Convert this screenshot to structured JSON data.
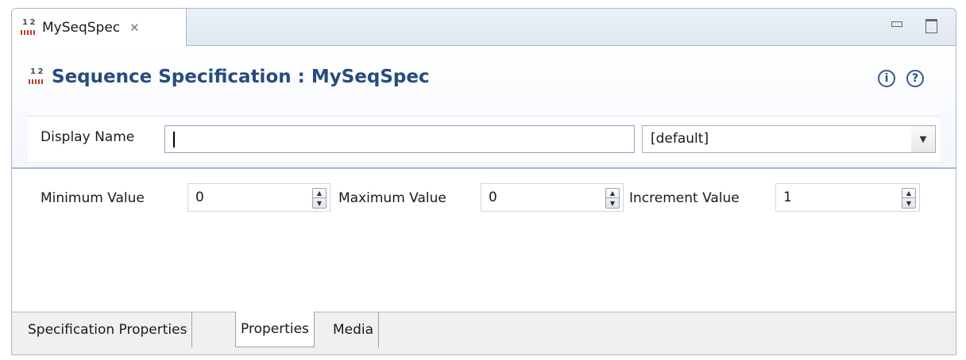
{
  "editor_tab": {
    "label": "MySeqSpec",
    "close_glyph": "✕"
  },
  "header": {
    "title": "Sequence Specification : MySeqSpec",
    "icons": [
      "info-icon",
      "help-icon"
    ]
  },
  "display_name": {
    "label": "Display Name",
    "value": "",
    "language_select": "[default]"
  },
  "fields": {
    "minimum": {
      "label": "Minimum Value",
      "value": "0"
    },
    "maximum": {
      "label": "Maximum Value",
      "value": "0"
    },
    "increment": {
      "label": "Increment Value",
      "value": "1"
    }
  },
  "bottom_tabs": [
    {
      "label": "Specification Properties",
      "active": false
    },
    {
      "label": "Properties",
      "active": true
    },
    {
      "label": "Media",
      "active": false
    }
  ],
  "colors": {
    "title": "#274b80",
    "border": "#a9b8cc",
    "sequence_icon_bars": "#c0392b"
  }
}
